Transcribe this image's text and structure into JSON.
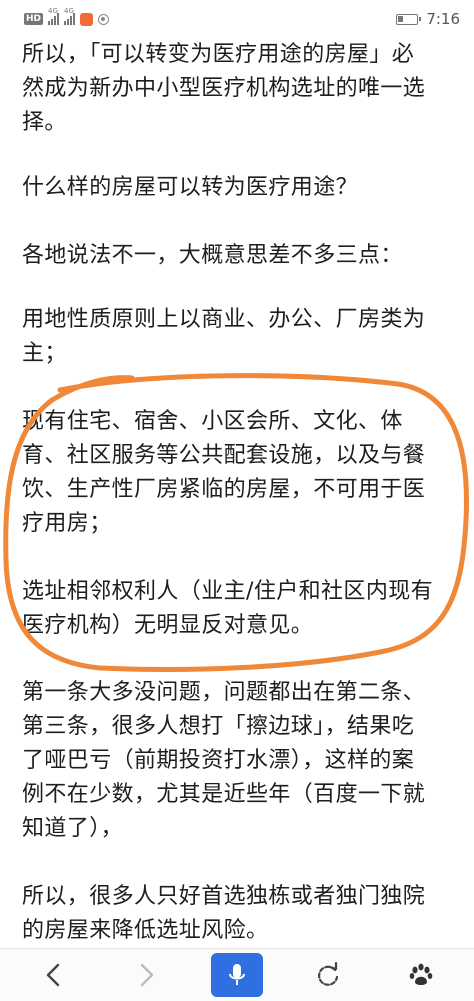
{
  "status_bar": {
    "hd": "HD",
    "signal1": "4G",
    "signal2": "4G",
    "time": "7:16"
  },
  "article": {
    "p1": [
      "所以，「可以转变为医疗用途的房屋」必",
      "然成为新办中小型医疗机构选址的唯一选",
      "择。"
    ],
    "p2": [
      "什么样的房屋可以转为医疗用途？"
    ],
    "p3": [
      "各地说法不一，大概意思差不多三点："
    ],
    "p4": [
      "用地性质原则上以商业、办公、厂房类为",
      "主；"
    ],
    "p5": [
      "现有住宅、宿舍、小区会所、文化、体",
      "育、社区服务等公共配套设施，以及与餐",
      "饮、生产性厂房紧临的房屋，不可用于医",
      "疗用房；"
    ],
    "p6": [
      "选址相邻权利人（业主/住户和社区内现有",
      "医疗机构）无明显反对意见。"
    ],
    "p7": [
      "第一条大多没问题，问题都出在第二条、",
      "第三条，很多人想打「擦边球」，结果吃",
      "了哑巴亏（前期投资打水漂），这样的案",
      "例不在少数，尤其是近些年（百度一下就",
      "知道了），"
    ],
    "p8": [
      "所以，很多人只好首选独栋或者独门独院",
      "的房屋来降低选址风险。"
    ]
  },
  "annotation": {
    "color": "#f0883a"
  },
  "nav": {
    "back_icon": "chevron-left-icon",
    "forward_icon": "chevron-right-icon",
    "mic_icon": "microphone-icon",
    "refresh_icon": "refresh-icon",
    "paw_icon": "paw-icon",
    "mic_color": "#2f6fe0"
  }
}
